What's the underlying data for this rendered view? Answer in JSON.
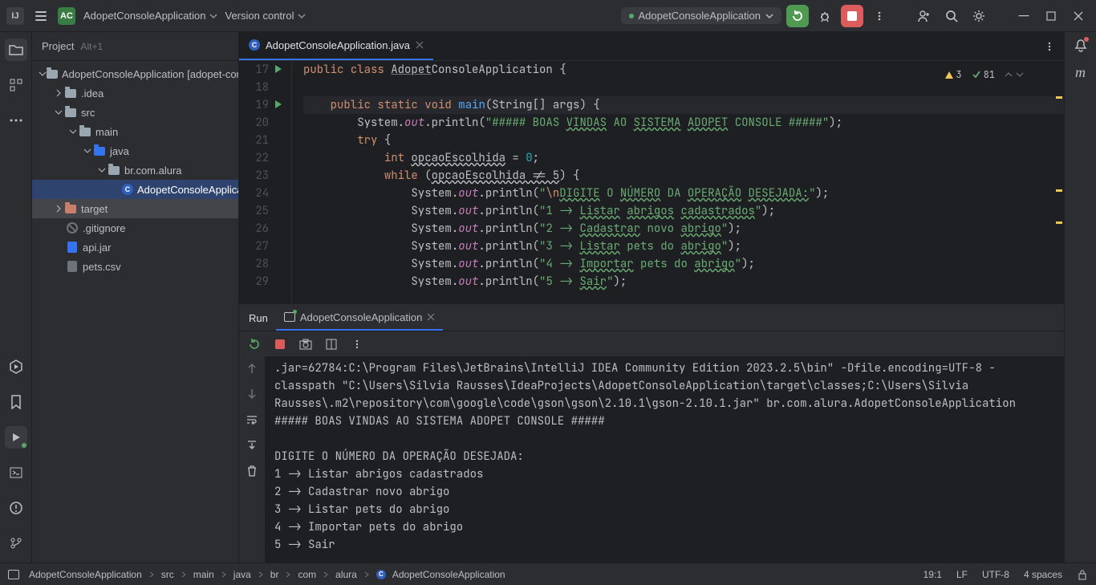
{
  "titlebar": {
    "project_badge": "AC",
    "project_name": "AdopetConsoleApplication",
    "vcs_label": "Version control",
    "run_config": "AdopetConsoleApplication"
  },
  "project_panel": {
    "title": "Project",
    "shortcut": "Alt+1"
  },
  "tree": {
    "root": "AdopetConsoleApplication",
    "root_suffix": " [adopet-console]",
    "idea": ".idea",
    "src": "src",
    "main": "main",
    "java": "java",
    "pkg": "br.com.alura",
    "cls": "AdopetConsoleApplication",
    "target": "target",
    "gitignore": ".gitignore",
    "apijar": "api.jar",
    "petscsv": "pets.csv"
  },
  "editor": {
    "tab": "AdopetConsoleApplication.java",
    "lines": {
      "start": 17
    },
    "inspections": {
      "warnings": "3",
      "typos": "81"
    }
  },
  "code": {
    "l17": {
      "kw1": "public",
      "kw2": "class",
      "cls": "Adopet",
      "rest": "ConsoleApplication {"
    },
    "l19": {
      "kw1": "public",
      "kw2": "static",
      "kw3": "void",
      "mth": "main",
      "sig": "(String[] args) {"
    },
    "l20": {
      "sys": "System",
      "out": "out",
      "pr": "println",
      "s": "\"##### BOAS ",
      "w1": "VINDAS",
      "s2": " AO ",
      "w2": "SISTEMA",
      "s3": " ",
      "w3": "ADOPET",
      "s4": " CONSOLE #####\"",
      "end": ");"
    },
    "l21": {
      "kw": "try",
      "br": " {"
    },
    "l22": {
      "kw": "int",
      "var": "opcaoEscolhida",
      "eq": " = ",
      "num": "0",
      "end": ";"
    },
    "l23": {
      "kw": "while",
      "open": " (",
      "var": "opcaoEscolhida != 5",
      "close": ") {"
    },
    "l24": {
      "sys": "System",
      "out": "out",
      "pr": "println",
      "s1": "\"",
      "esc": "\\n",
      "w1": "DIGITE",
      "s2": " O ",
      "w2": "NÚMERO",
      "s3": " DA ",
      "w3": "OPERAÇÃO",
      "s4": " ",
      "w4": "DESEJADA:",
      "s5": "\"",
      "end": ");"
    },
    "l25": {
      "sys": "System",
      "out": "out",
      "pr": "println",
      "s": "\"1 -> ",
      "w1": "Listar",
      "s2": " ",
      "w2": "abrigos",
      "s3": " ",
      "w3": "cadastrados",
      "s4": "\"",
      "end": ");"
    },
    "l26": {
      "sys": "System",
      "out": "out",
      "pr": "println",
      "s": "\"2 -> ",
      "w1": "Cadastrar",
      "s2": " novo ",
      "w2": "abrigo",
      "s3": "\"",
      "end": ");"
    },
    "l27": {
      "sys": "System",
      "out": "out",
      "pr": "println",
      "s": "\"3 -> ",
      "w1": "Listar",
      "s2": " pets do ",
      "w2": "abrigo",
      "s3": "\"",
      "end": ");"
    },
    "l28": {
      "sys": "System",
      "out": "out",
      "pr": "println",
      "s": "\"4 -> ",
      "w1": "Importar",
      "s2": " pets do ",
      "w2": "abrigo",
      "s3": "\"",
      "end": ");"
    },
    "l29": {
      "sys": "System",
      "out": "out",
      "pr": "println",
      "s": "\"5 -> ",
      "w1": "Sair",
      "s2": "\"",
      "end": ");"
    }
  },
  "run": {
    "tab_label": "Run",
    "config": "AdopetConsoleApplication",
    "output": ".jar=62784:C:\\Program Files\\JetBrains\\IntelliJ IDEA Community Edition 2023.2.5\\bin\" -Dfile.encoding=UTF-8 -classpath \"C:\\Users\\Silvia Rausses\\IdeaProjects\\AdopetConsoleApplication\\target\\classes;C:\\Users\\Silvia Rausses\\.m2\\repository\\com\\google\\code\\gson\\gson\\2.10.1\\gson-2.10.1.jar\" br.com.alura.AdopetConsoleApplication\n##### BOAS VINDAS AO SISTEMA ADOPET CONSOLE #####\n\nDIGITE O NÚMERO DA OPERAÇÃO DESEJADA:\n1 -> Listar abrigos cadastrados\n2 -> Cadastrar novo abrigo\n3 -> Listar pets do abrigo\n4 -> Importar pets do abrigo\n5 -> Sair\n"
  },
  "statusbar": {
    "crumbs": [
      "AdopetConsoleApplication",
      "src",
      "main",
      "java",
      "br",
      "com",
      "alura",
      "AdopetConsoleApplication"
    ],
    "pos": "19:1",
    "le": "LF",
    "enc": "UTF-8",
    "indent": "4 spaces"
  }
}
